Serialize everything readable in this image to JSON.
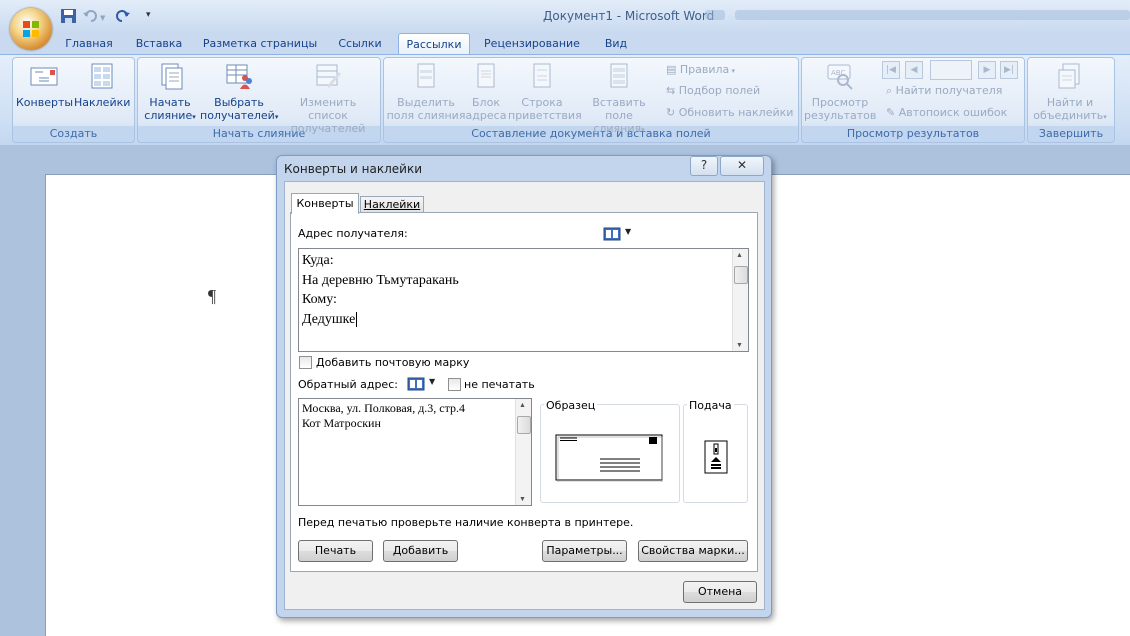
{
  "window": {
    "title": "Документ1 - Microsoft Word"
  },
  "ribbon_tabs": [
    "Главная",
    "Вставка",
    "Разметка страницы",
    "Ссылки",
    "Рассылки",
    "Рецензирование",
    "Вид"
  ],
  "ribbon": {
    "create": {
      "label": "Создать",
      "envelopes": "Конверты",
      "labels": "Наклейки"
    },
    "start_merge": {
      "label": "Начать слияние",
      "start_1": "Начать",
      "start_2": "слияние",
      "select_1": "Выбрать",
      "select_2": "получателей",
      "edit_1": "Изменить список",
      "edit_2": "получателей"
    },
    "write_insert": {
      "label": "Составление документа и вставка полей",
      "highlight_1": "Выделить",
      "highlight_2": "поля слияния",
      "address_1": "Блок",
      "address_2": "адреса",
      "greeting_1": "Строка",
      "greeting_2": "приветствия",
      "insert_1": "Вставить поле",
      "insert_2": "слияния",
      "rules": "Правила",
      "match": "Подбор полей",
      "update": "Обновить наклейки"
    },
    "preview": {
      "label": "Просмотр результатов",
      "preview_1": "Просмотр",
      "preview_2": "результатов",
      "find": "Найти получателя",
      "auto": "Автопоиск ошибок"
    },
    "finish": {
      "label": "Завершить",
      "finish_1": "Найти и",
      "finish_2": "объединить"
    }
  },
  "document": {
    "pilcrow": "¶"
  },
  "dialog": {
    "title": "Конверты и наклейки",
    "help": "?",
    "close": "✕",
    "tabs": [
      "Конверты",
      "Наклейки"
    ],
    "recipient_label": "Адрес получателя:",
    "recipient_lines": [
      "Куда:",
      "На деревню Тьмутаракань",
      "Кому:",
      "Дедушке"
    ],
    "add_stamp": "Добавить почтовую марку",
    "return_label": "Обратный адрес:",
    "omit": "не печатать",
    "return_lines": [
      "Москва, ул. Полковая, д.3, стр.4",
      "Кот Матроскин"
    ],
    "preview_label": "Образец",
    "feed_label": "Подача",
    "note": "Перед печатью проверьте наличие конверта в принтере.",
    "buttons": {
      "print": "Печать",
      "add": "Добавить",
      "options": "Параметры...",
      "epostage": "Свойства марки...",
      "cancel": "Отмена"
    }
  },
  "colors": {
    "ribbon_bg": "#cfe0f4",
    "page": "#ffffff",
    "dialog_frame": "#c3d5ec"
  }
}
